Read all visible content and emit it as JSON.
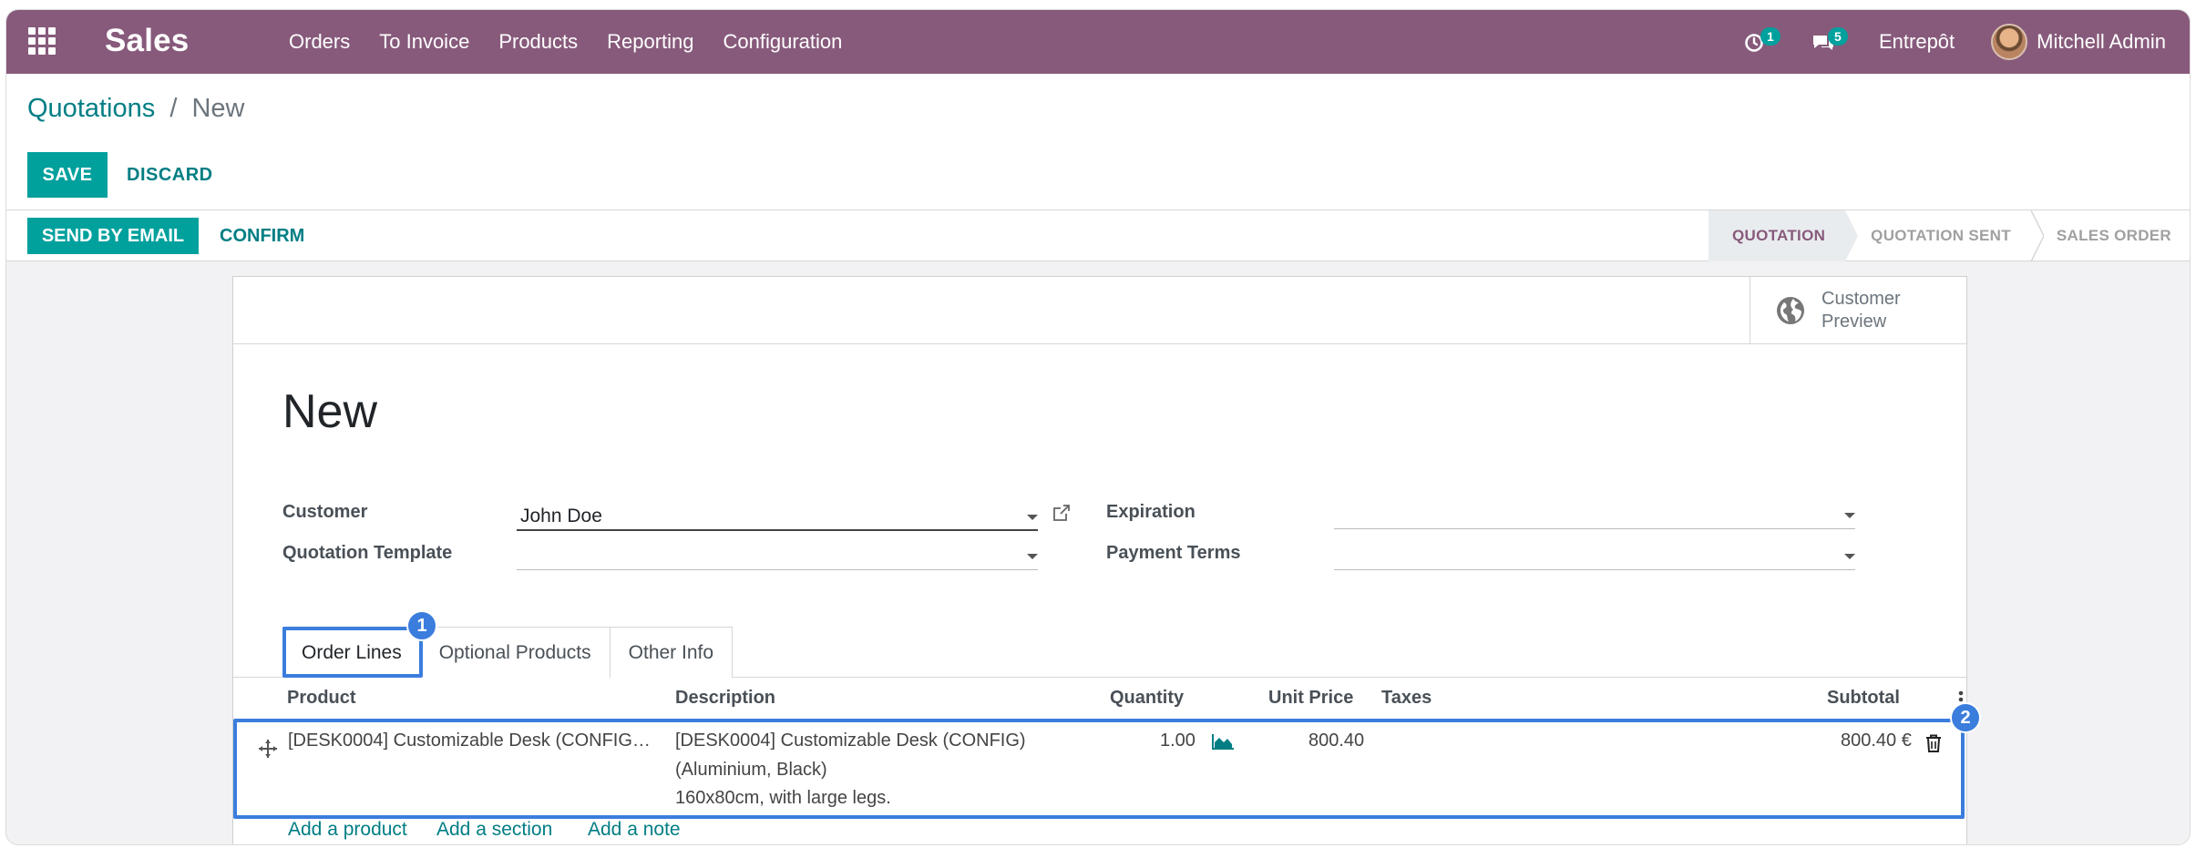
{
  "navbar": {
    "app_name": "Sales",
    "menu": [
      "Orders",
      "To Invoice",
      "Products",
      "Reporting",
      "Configuration"
    ],
    "activity_count": "1",
    "messages_count": "5",
    "company": "Entrepôt",
    "user": "Mitchell Admin"
  },
  "breadcrumb": {
    "parent": "Quotations",
    "separator": "/",
    "current": "New"
  },
  "actions": {
    "save": "SAVE",
    "discard": "DISCARD"
  },
  "statusbar": {
    "send_email": "SEND BY EMAIL",
    "confirm": "CONFIRM",
    "stages": [
      "QUOTATION",
      "QUOTATION SENT",
      "SALES ORDER"
    ],
    "active_stage": "QUOTATION"
  },
  "sheet": {
    "preview_line1": "Customer",
    "preview_line2": "Preview",
    "title": "New",
    "fields": {
      "customer_label": "Customer",
      "customer_value": "John Doe",
      "template_label": "Quotation Template",
      "template_value": "",
      "expiration_label": "Expiration",
      "expiration_value": "",
      "payment_label": "Payment Terms",
      "payment_value": ""
    },
    "tabs": [
      "Order Lines",
      "Optional Products",
      "Other Info"
    ],
    "callouts": [
      "1",
      "2"
    ],
    "table": {
      "headers": [
        "Product",
        "Description",
        "Quantity",
        "Unit Price",
        "Taxes",
        "Subtotal"
      ],
      "row": {
        "product": "[DESK0004] Customizable Desk (CONFIG…",
        "description_1": "[DESK0004] Customizable Desk (CONFIG)",
        "description_2": "(Aluminium, Black)",
        "description_3": "160x80cm, with large legs.",
        "quantity": "1.00",
        "unit_price": "800.40",
        "taxes": "",
        "subtotal": "800.40 €"
      }
    },
    "add_links": [
      "Add a product",
      "Add a section",
      "Add a note"
    ]
  },
  "colors": {
    "brand": "#875a7b",
    "primary": "#00a09d",
    "link": "#017e84",
    "callout": "#3b7ddd"
  }
}
